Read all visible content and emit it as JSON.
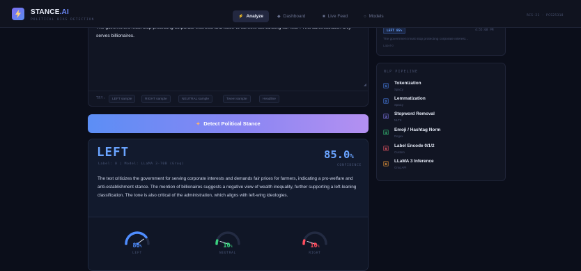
{
  "app": {
    "name_main": "STANCE",
    "name_accent": ".AI",
    "subtitle": "POLITICAL BIAS DETECTION",
    "version": "RCS-21 · PCS25318"
  },
  "nav": [
    {
      "label": "Analyze",
      "icon": "⚡",
      "active": true
    },
    {
      "label": "Dashboard",
      "icon": "◆",
      "active": false
    },
    {
      "label": "Live Feed",
      "icon": "■",
      "active": false
    },
    {
      "label": "Models",
      "icon": "○",
      "active": false
    }
  ],
  "input": {
    "text": "The government must stop protecting corporate interests and listen to farmers demanding fair MSP. This administration only serves billionaires.",
    "try_label": "TRY:",
    "samples": [
      "LEFT sample",
      "RIGHT sample",
      "NEUTRAL sample",
      "Tweet sample",
      "Headline"
    ]
  },
  "detect_button": {
    "label": "Detect Political Stance",
    "icon": "✦"
  },
  "result": {
    "stance": "LEFT",
    "meta": "Label: 0  |  Model: LLaMA 3-70B (Groq)",
    "confidence_value": "85.0",
    "confidence_unit": "%",
    "confidence_label": "CONFIDENCE",
    "explanation": "The text criticizes the government for serving corporate interests and demands fair prices for farmers, indicating a pro-welfare and anti-establishment stance. The mention of billionaires suggests a negative view of wealth inequality, further supporting a left-leaning classification. The tone is also critical of the administration, which aligns with left-wing ideologies.",
    "gauges": [
      {
        "name": "LEFT",
        "value": "80",
        "unit": "%",
        "fraction": 0.8,
        "color": "#4f8dff"
      },
      {
        "name": "NEUTRAL",
        "value": "10",
        "unit": "%",
        "fraction": 0.1,
        "color": "#3ad07e"
      },
      {
        "name": "RIGHT",
        "value": "10",
        "unit": "%",
        "fraction": 0.1,
        "color": "#ff4d5e"
      }
    ]
  },
  "live": {
    "badge": "LEFT 85%",
    "time": "4:55:08 PM",
    "text": "The government must stop protecting corporate interest...",
    "tag": "Label-0"
  },
  "pipeline": {
    "title": "NLP PIPELINE",
    "steps": [
      {
        "num": "1",
        "name": "Tokenization",
        "lib": "SpaCy",
        "color": "#4f8dff"
      },
      {
        "num": "2",
        "name": "Lemmatization",
        "lib": "SpaCy",
        "color": "#4f8dff"
      },
      {
        "num": "3",
        "name": "Stopword Removal",
        "lib": "NLTK",
        "color": "#8a7cf5"
      },
      {
        "num": "4",
        "name": "Emoji / Hashtag Norm",
        "lib": "Regex",
        "color": "#3ad07e"
      },
      {
        "num": "5",
        "name": "Label Encode 0/1/2",
        "lib": "Custom",
        "color": "#ff5d6c"
      },
      {
        "num": "6",
        "name": "LLaMA 3 Inference",
        "lib": "Groq API",
        "color": "#ffa23d"
      }
    ]
  }
}
